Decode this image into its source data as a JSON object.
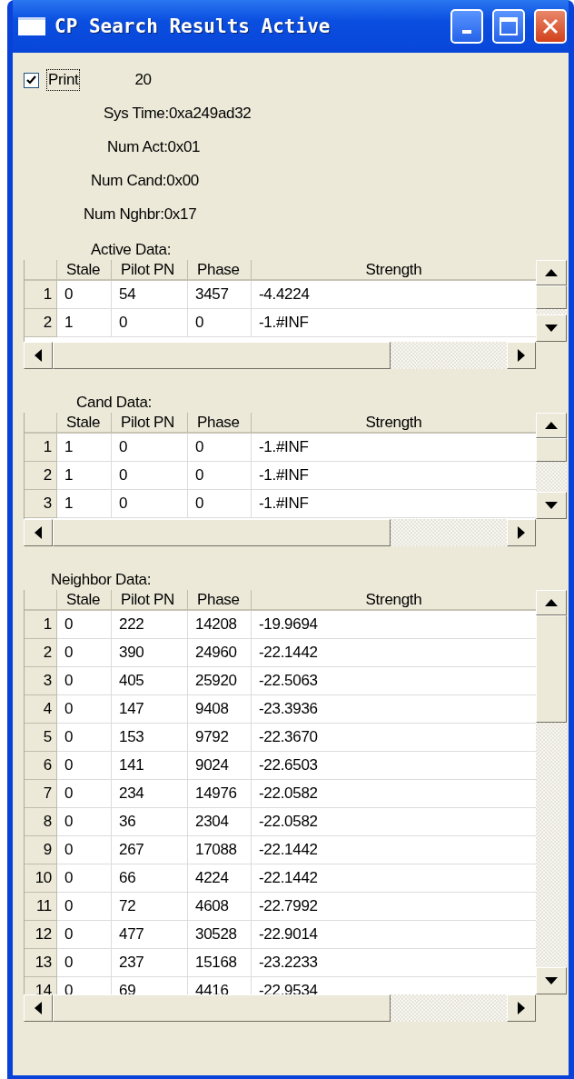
{
  "window": {
    "title": "CP Search Results Active"
  },
  "print": {
    "label": "Print",
    "checked": true,
    "value": "20"
  },
  "info": [
    "Sys Time:0xa249ad32",
    "Num Act:0x01",
    "Num Cand:0x00",
    "Num Nghbr:0x17"
  ],
  "grids": [
    {
      "label": "Active Data:",
      "columns": [
        "",
        "Stale",
        "Pilot PN",
        "Phase",
        "Strength"
      ],
      "rows": [
        [
          "1",
          "0",
          "54",
          "3457",
          "-4.4224"
        ],
        [
          "2",
          "1",
          "0",
          "0",
          "-1.#INF"
        ]
      ]
    },
    {
      "label": "Cand Data:",
      "columns": [
        "",
        "Stale",
        "Pilot PN",
        "Phase",
        "Strength"
      ],
      "rows": [
        [
          "1",
          "1",
          "0",
          "0",
          "-1.#INF"
        ],
        [
          "2",
          "1",
          "0",
          "0",
          "-1.#INF"
        ],
        [
          "3",
          "1",
          "0",
          "0",
          "-1.#INF"
        ]
      ]
    },
    {
      "label": "Neighbor Data:",
      "columns": [
        "",
        "Stale",
        "Pilot PN",
        "Phase",
        "Strength"
      ],
      "rows": [
        [
          "1",
          "0",
          "222",
          "14208",
          "-19.9694"
        ],
        [
          "2",
          "0",
          "390",
          "24960",
          "-22.1442"
        ],
        [
          "3",
          "0",
          "405",
          "25920",
          "-22.5063"
        ],
        [
          "4",
          "0",
          "147",
          "9408",
          "-23.3936"
        ],
        [
          "5",
          "0",
          "153",
          "9792",
          "-22.3670"
        ],
        [
          "6",
          "0",
          "141",
          "9024",
          "-22.6503"
        ],
        [
          "7",
          "0",
          "234",
          "14976",
          "-22.0582"
        ],
        [
          "8",
          "0",
          "36",
          "2304",
          "-22.0582"
        ],
        [
          "9",
          "0",
          "267",
          "17088",
          "-22.1442"
        ],
        [
          "10",
          "0",
          "66",
          "4224",
          "-22.1442"
        ],
        [
          "11",
          "0",
          "72",
          "4608",
          "-22.7992"
        ],
        [
          "12",
          "0",
          "477",
          "30528",
          "-22.9014"
        ],
        [
          "13",
          "0",
          "237",
          "15168",
          "-23.2233"
        ],
        [
          "14",
          "0",
          "69",
          "4416",
          "-22.9534"
        ]
      ]
    }
  ]
}
